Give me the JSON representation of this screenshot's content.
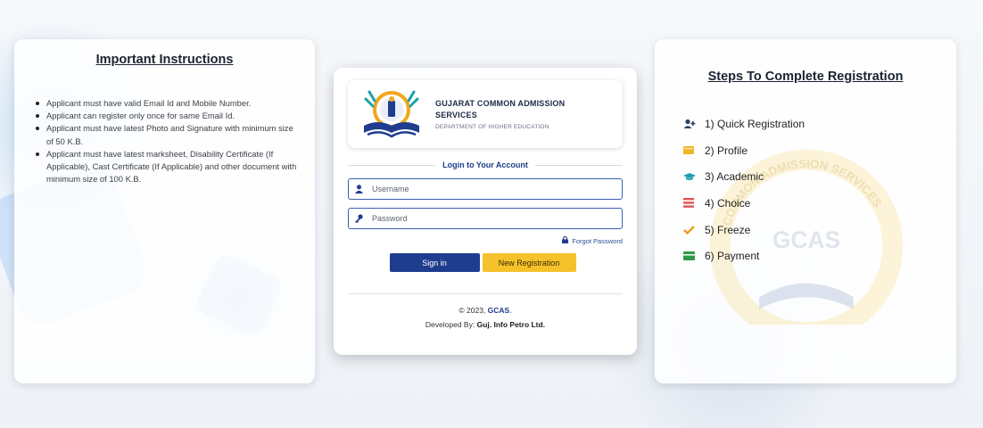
{
  "instructions": {
    "heading": "Important Instructions",
    "items": [
      "Applicant must have valid Email Id and Mobile Number.",
      "Applicant can register only once for same Email Id.",
      "Applicant must have latest Photo and Signature with minimum size of 50 K.B.",
      "Applicant must have latest marksheet, Disability Certificate (If Applicable), Cast Certificate (If Applicable) and other document with minimum size of 100 K.B."
    ]
  },
  "login": {
    "brand_title_line1": "GUJARAT COMMON ADMISSION",
    "brand_title_line2": "SERVICES",
    "brand_subtitle": "DEPARTMENT OF HIGHER EDUCATION",
    "caption": "Login to Your Account",
    "username_placeholder": "Username",
    "password_placeholder": "Password",
    "forgot_label": "Forgot Password",
    "signin_label": "Sign in",
    "new_registration_label": "New Registration",
    "footer_copyright_prefix": "© 2023,",
    "footer_brand": "GCAS",
    "footer_copyright_suffix": ".",
    "footer_developed_prefix": "Developed By:",
    "footer_developer": "Guj. Info Petro Ltd."
  },
  "steps": {
    "heading": "Steps To Complete Registration",
    "items": [
      {
        "label": "1) Quick Registration",
        "icon": "user-plus-icon",
        "color": "#2c3e63"
      },
      {
        "label": "2) Profile",
        "icon": "id-card-icon",
        "color": "#f0b429"
      },
      {
        "label": "3) Academic",
        "icon": "graduation-cap-icon",
        "color": "#1aa1a8"
      },
      {
        "label": "4) Choice",
        "icon": "list-icon",
        "color": "#e05555"
      },
      {
        "label": "5) Freeze",
        "icon": "check-icon",
        "color": "#f09a1a"
      },
      {
        "label": "6) Payment",
        "icon": "money-icon",
        "color": "#2e9a4a"
      }
    ]
  },
  "watermark": {
    "arc_text": "COMMON ADMISSION SERVICES",
    "center_text": "GCAS"
  },
  "colors": {
    "primary": "#1f3d8f",
    "accent": "#f6c22c"
  }
}
